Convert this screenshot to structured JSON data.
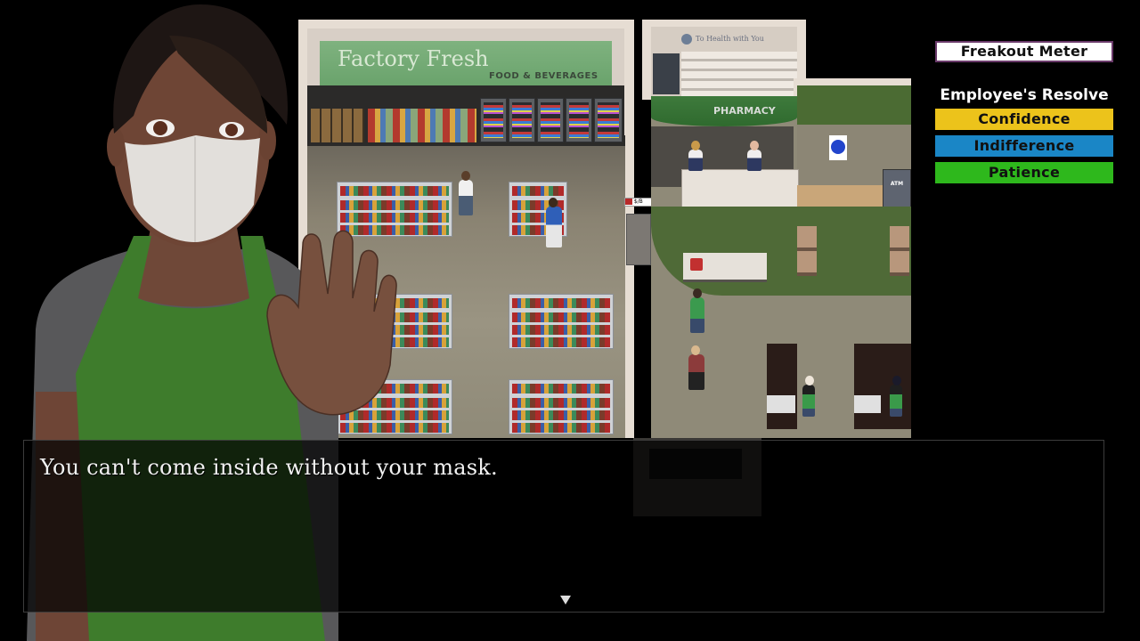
{
  "scene": {
    "store_sign": {
      "title": "Factory Fresh",
      "subtitle": "FOOD & BEVERAGES"
    },
    "pharmacy_banner": "PHARMACY",
    "pharmacy_brand": "To Health with You",
    "atm_label": "ATM",
    "price_tag": "$/B"
  },
  "hud": {
    "freakout_meter_label": "Freakout Meter",
    "resolve_title": "Employee's Resolve",
    "resolve_bars": [
      {
        "label": "Confidence",
        "color": "#ecc31b"
      },
      {
        "label": "Indifference",
        "color": "#1a86c6"
      },
      {
        "label": "Patience",
        "color": "#2eb81c"
      }
    ]
  },
  "dialog": {
    "text": "You can't come inside without your mask.",
    "advance_icon": "triangle-down-icon"
  },
  "colors": {
    "apron_green": "#3f7a2e",
    "shirt_gray": "#5a5a5c",
    "skin": "#7a5140",
    "mask": "#e2dfdb",
    "hair": "#1e1714"
  }
}
